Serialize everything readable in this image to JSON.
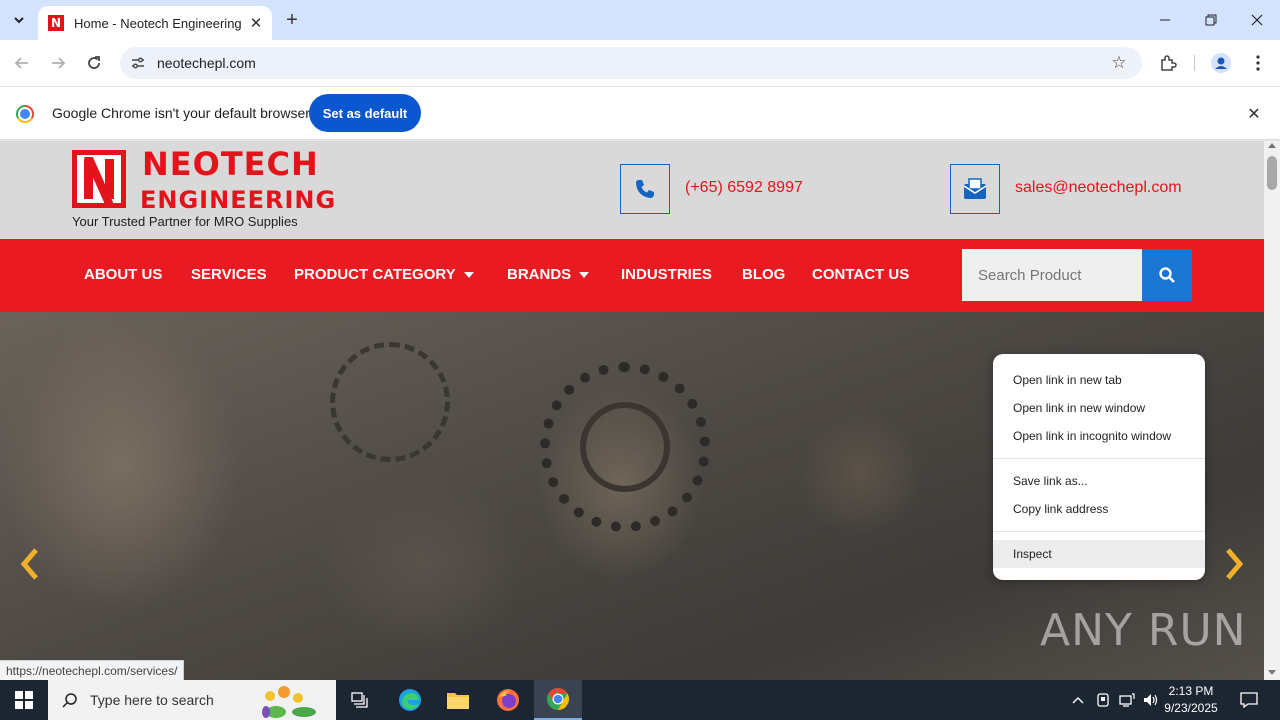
{
  "browser": {
    "tab": {
      "title": "Home - Neotech Engineering",
      "favicon": "N"
    },
    "new_tab": "+",
    "url": "neotechepl.com",
    "infobar": {
      "message": "Google Chrome isn't your default browser",
      "button": "Set as default"
    }
  },
  "site": {
    "logo_line1": "NEOTECH",
    "logo_line2": "ENGINEERING",
    "tagline": "Your Trusted Partner for MRO Supplies",
    "phone": "(+65) 6592 8997",
    "email": "sales@neotechepl.com",
    "nav": [
      "ABOUT US",
      "SERVICES",
      "PRODUCT CATEGORY",
      "BRANDS",
      "INDUSTRIES",
      "BLOG",
      "CONTACT US"
    ],
    "search_placeholder": "Search Product"
  },
  "context_menu": {
    "items": [
      "Open link in new tab",
      "Open link in new window",
      "Open link in incognito window",
      "Save link as...",
      "Copy link address",
      "Inspect"
    ]
  },
  "status_url": "https://neotechepl.com/services/",
  "watermark": "ANY RUN",
  "taskbar": {
    "search_placeholder": "Type here to search",
    "time": "2:13 PM",
    "date": "9/23/2025"
  },
  "colors": {
    "brand_red": "#e3131b",
    "nav_red": "#ea1a22",
    "accent_blue": "#1976d2",
    "chrome_blue": "#0b57d0"
  }
}
